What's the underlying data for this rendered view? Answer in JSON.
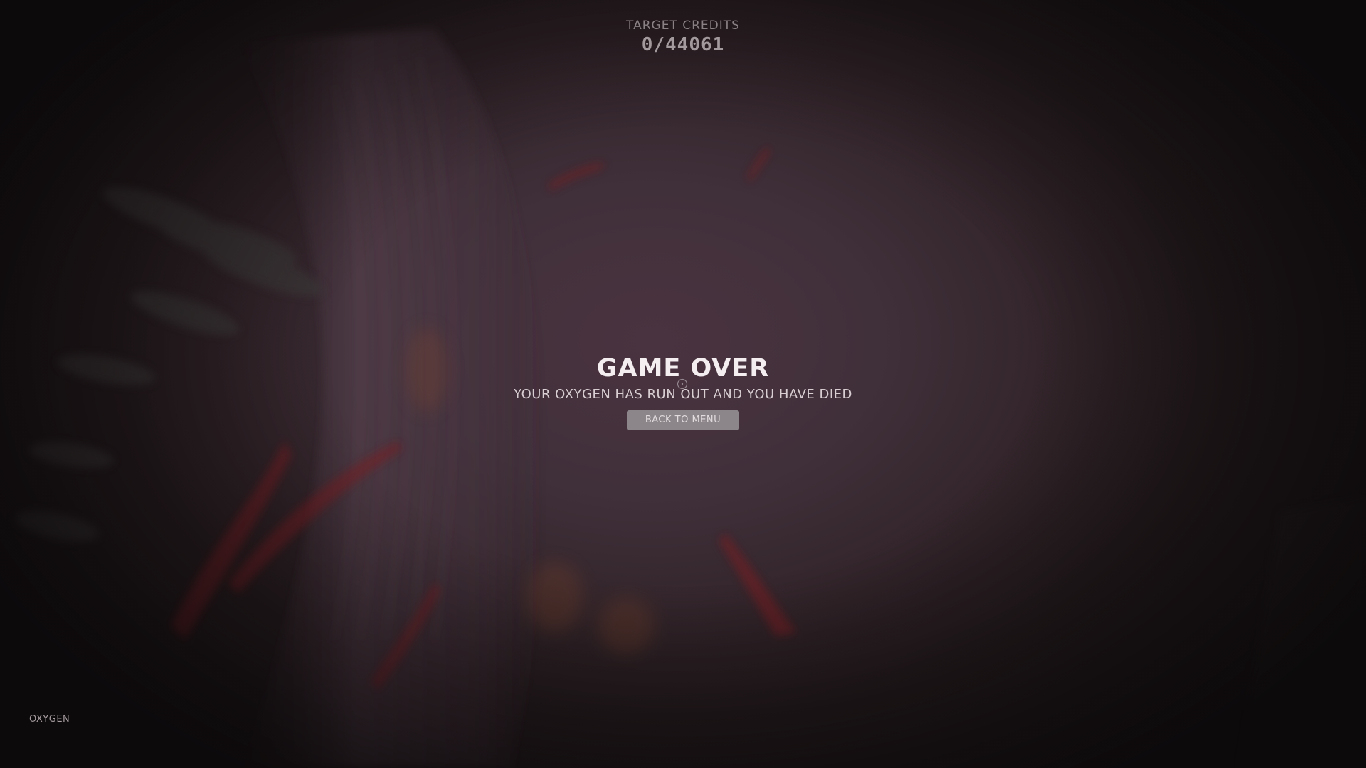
{
  "hud": {
    "credits_label": "TARGET CREDITS",
    "credits_value": "0/44061"
  },
  "game_over": {
    "title": "GAME OVER",
    "message": "YOUR OXYGEN HAS RUN OUT AND YOU HAVE DIED",
    "button_label": "BACK TO MENU"
  },
  "oxygen": {
    "label": "OXYGEN",
    "level": 0
  },
  "colors": {
    "title": "#f4eef0",
    "button_bg": "#8c8589",
    "background_tint": "#4a3340",
    "blood": "#7a1d22"
  },
  "icons": {
    "crosshair": "crosshair-icon"
  }
}
